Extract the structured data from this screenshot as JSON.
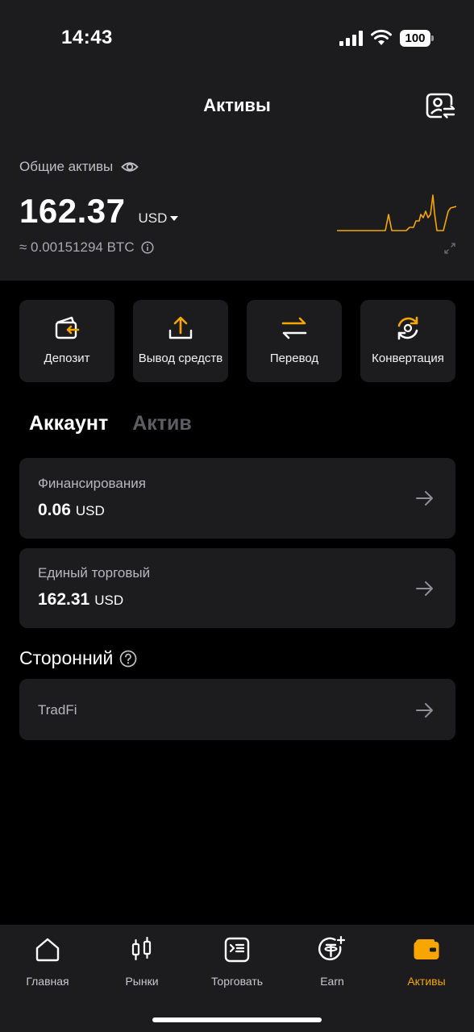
{
  "status_bar": {
    "time": "14:43",
    "battery": "100"
  },
  "header": {
    "title": "Активы"
  },
  "overview": {
    "total_label": "Общие активы",
    "balance": "162.37",
    "currency": "USD",
    "btc_equivalent": "≈ 0.00151294 BTC"
  },
  "actions": [
    {
      "label": "Депозит",
      "icon": "deposit-icon"
    },
    {
      "label": "Вывод средств",
      "icon": "withdraw-icon"
    },
    {
      "label": "Перевод",
      "icon": "transfer-icon"
    },
    {
      "label": "Конвертация",
      "icon": "convert-icon"
    }
  ],
  "tabs": [
    {
      "label": "Аккаунт",
      "active": true
    },
    {
      "label": "Актив",
      "active": false
    }
  ],
  "accounts": [
    {
      "title": "Финансирования",
      "amount": "0.06",
      "currency": "USD"
    },
    {
      "title": "Единый торговый",
      "amount": "162.31",
      "currency": "USD"
    }
  ],
  "third_party": {
    "title": "Сторонний",
    "items": [
      {
        "title": "TradFi"
      }
    ]
  },
  "bottom_nav": [
    {
      "label": "Главная",
      "icon": "home-icon",
      "active": false
    },
    {
      "label": "Рынки",
      "icon": "candlestick-icon",
      "active": false
    },
    {
      "label": "Торговать",
      "icon": "trade-icon",
      "active": false
    },
    {
      "label": "Earn",
      "icon": "earn-icon",
      "active": false
    },
    {
      "label": "Активы",
      "icon": "wallet-icon",
      "active": true
    }
  ],
  "colors": {
    "accent": "#f7a600",
    "background": "#000000",
    "surface": "#1c1c1e"
  }
}
